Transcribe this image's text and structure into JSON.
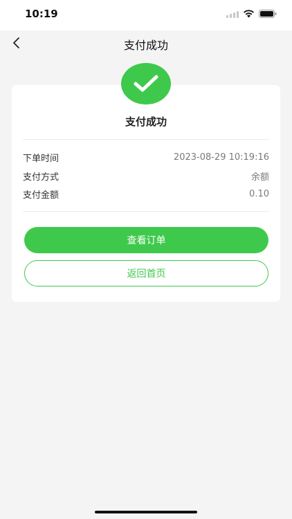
{
  "status_bar": {
    "time": "10:19"
  },
  "nav": {
    "title": "支付成功",
    "back_icon": "chevron-left-icon"
  },
  "result": {
    "icon": "check-icon",
    "title": "支付成功",
    "accent_color": "#3fc94c"
  },
  "details": [
    {
      "label": "下单时间",
      "value": "2023-08-29 10:19:16"
    },
    {
      "label": "支付方式",
      "value": "余额"
    },
    {
      "label": "支付金额",
      "value": "0.10"
    }
  ],
  "actions": {
    "view_order_label": "查看订单",
    "back_home_label": "返回首页"
  }
}
